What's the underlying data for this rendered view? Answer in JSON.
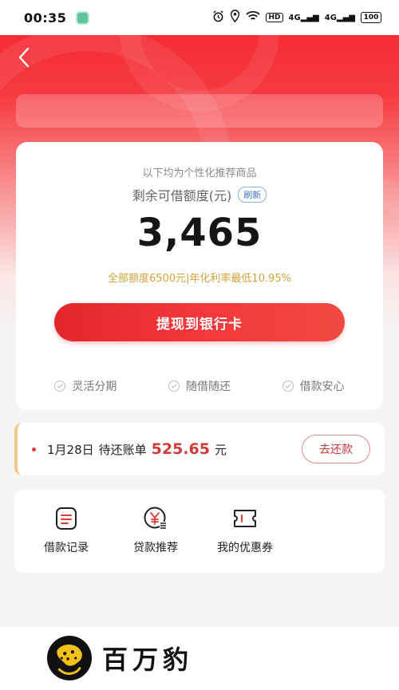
{
  "status_bar": {
    "time": "00:35",
    "hd_badge": "HD",
    "sig1": "4G",
    "sig2": "4G",
    "battery": "100"
  },
  "header": {
    "back_icon": "chevron-left-icon"
  },
  "credit_card": {
    "subtitle": "以下均为个性化推荐商品",
    "credit_label": "剩余可借额度(元)",
    "refresh_label": "刷新",
    "available_amount": "3,465",
    "limit_info": "全部额度6500元|年化利率最低10.95%",
    "withdraw_label": "提现到银行卡",
    "features": [
      {
        "label": "灵活分期"
      },
      {
        "label": "随借随还"
      },
      {
        "label": "借款安心"
      }
    ]
  },
  "bill": {
    "date": "1月28日",
    "label": "待还账单",
    "amount": "525.65",
    "unit": "元",
    "repay_label": "去还款"
  },
  "menu": [
    {
      "label": "借款记录",
      "icon": "document-icon"
    },
    {
      "label": "贷款推荐",
      "icon": "yuan-coin-icon"
    },
    {
      "label": "我的优惠券",
      "icon": "coupon-icon"
    }
  ],
  "brand": {
    "name": "百万豹",
    "logo": "leopard-logo-icon"
  },
  "colors": {
    "primary_red": "#f2383b",
    "gold_text": "#d4a23a",
    "bill_amount_red": "#d13a3a"
  }
}
